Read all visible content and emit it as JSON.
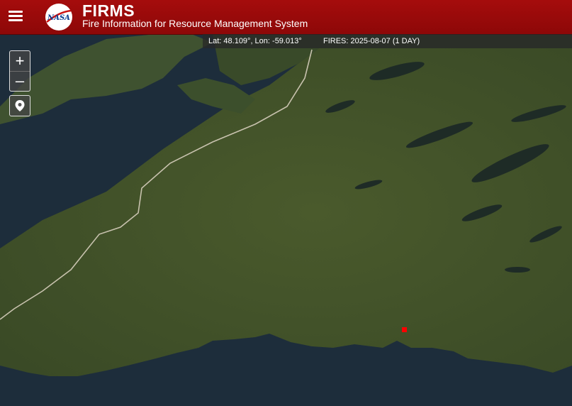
{
  "header": {
    "title": "FIRMS",
    "subtitle": "Fire Information for Resource Management System",
    "logo_text": "NASA"
  },
  "status_bar": {
    "coordinates": "Lat: 48.109°, Lon: -59.013°",
    "fires": "FIRES: 2025-08-07 (1 DAY)"
  },
  "controls": {
    "zoom_in": "+",
    "zoom_out": "–"
  },
  "icons": [
    "menu-icon",
    "nasa-logo",
    "zoom-in-icon",
    "zoom-out-icon",
    "location-pin-icon"
  ],
  "map": {
    "basemap": "satellite imagery",
    "fire_points": [
      {
        "lat": 47.62,
        "lon": -58.03,
        "color": "#ff0000"
      }
    ]
  }
}
